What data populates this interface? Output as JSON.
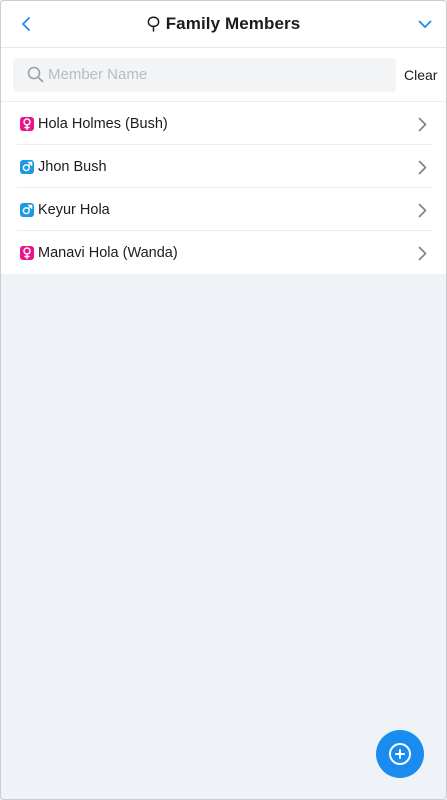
{
  "header": {
    "title": "Family Members",
    "title_icon": "tree-icon",
    "back_icon": "chevron-left-icon",
    "menu_icon": "chevron-down-icon"
  },
  "search": {
    "placeholder": "Member Name",
    "value": "",
    "clear_label": "Clear"
  },
  "members": [
    {
      "name": "Hola Holmes (Bush)",
      "gender": "female"
    },
    {
      "name": "Jhon Bush",
      "gender": "male"
    },
    {
      "name": "Keyur Hola",
      "gender": "male"
    },
    {
      "name": "Manavi Hola (Wanda)",
      "gender": "female"
    }
  ],
  "fab": {
    "icon": "add-circle-icon"
  },
  "colors": {
    "accent": "#1a8cf0",
    "female": "#e8168a",
    "male": "#1a9be0",
    "background": "#eff2f6"
  }
}
